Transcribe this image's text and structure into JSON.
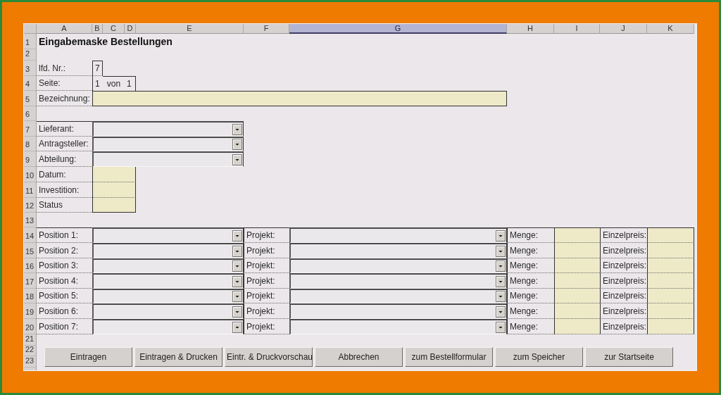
{
  "sheet": {
    "columns": [
      {
        "label": "A",
        "selected": false
      },
      {
        "label": "B",
        "selected": false
      },
      {
        "label": "C",
        "selected": false
      },
      {
        "label": "D",
        "selected": false
      },
      {
        "label": "E",
        "selected": false
      },
      {
        "label": "F",
        "selected": false
      },
      {
        "label": "G",
        "selected": true
      },
      {
        "label": "H",
        "selected": false
      },
      {
        "label": "I",
        "selected": false
      },
      {
        "label": "J",
        "selected": false
      },
      {
        "label": "K",
        "selected": false
      }
    ],
    "rows": [
      "1",
      "2",
      "3",
      "4",
      "5",
      "6",
      "7",
      "8",
      "9",
      "10",
      "11",
      "12",
      "13",
      "14",
      "15",
      "16",
      "17",
      "18",
      "19",
      "20",
      "21",
      "22",
      "23"
    ]
  },
  "form": {
    "title": "Eingabemaske Bestellungen",
    "number": {
      "label": "lfd. Nr.:",
      "value": "7"
    },
    "page": {
      "label": "Seite:",
      "current": "1",
      "separator": "von",
      "total": "1"
    },
    "description": {
      "label": "Bezeichnung:"
    },
    "selectors": [
      {
        "label": "Lieferant:"
      },
      {
        "label": "Antragsteller:"
      },
      {
        "label": "Abteilung:"
      }
    ],
    "details": [
      {
        "label": "Datum:"
      },
      {
        "label": "Investition:"
      },
      {
        "label": "Status"
      }
    ],
    "positions": [
      {
        "label": "Position 1:",
        "project_label": "Projekt:",
        "quantity_label": "Menge:",
        "price_label": "Einzelpreis:"
      },
      {
        "label": "Position 2:",
        "project_label": "Projekt:",
        "quantity_label": "Menge:",
        "price_label": "Einzelpreis:"
      },
      {
        "label": "Position 3:",
        "project_label": "Projekt:",
        "quantity_label": "Menge:",
        "price_label": "Einzelpreis:"
      },
      {
        "label": "Position 4:",
        "project_label": "Projekt:",
        "quantity_label": "Menge:",
        "price_label": "Einzelpreis:"
      },
      {
        "label": "Position 5:",
        "project_label": "Projekt:",
        "quantity_label": "Menge:",
        "price_label": "Einzelpreis:"
      },
      {
        "label": "Position 6:",
        "project_label": "Projekt:",
        "quantity_label": "Menge:",
        "price_label": "Einzelpreis:"
      },
      {
        "label": "Position 7:",
        "project_label": "Projekt:",
        "quantity_label": "Menge:",
        "price_label": "Einzelpreis:"
      }
    ]
  },
  "buttons": [
    "Eintragen",
    "Eintragen & Drucken",
    "Eintr. & Druckvorschau",
    "Abbrechen",
    "zum Bestellformular",
    "zum Speicher",
    "zur Startseite"
  ]
}
